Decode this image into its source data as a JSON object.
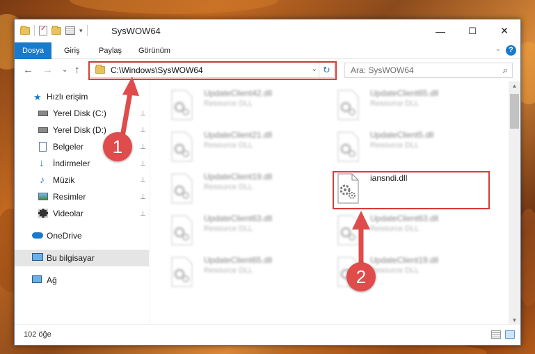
{
  "window": {
    "title": "SysWOW64"
  },
  "window_controls": {
    "minimize": "—",
    "maximize": "☐",
    "close": "✕"
  },
  "ribbon": {
    "tabs": [
      "Dosya",
      "Giriş",
      "Paylaş",
      "Görünüm"
    ],
    "help": "?",
    "collapse": "⌄"
  },
  "nav": {
    "back": "←",
    "forward": "→",
    "recent": "⌄",
    "up": "↑"
  },
  "address": {
    "path": "C:\\Windows\\SysWOW64",
    "dropdown": "⌄",
    "refresh": "↻"
  },
  "search": {
    "placeholder": "Ara: SysWOW64",
    "icon": "⌕"
  },
  "sidebar": {
    "items": [
      {
        "label": "Hızlı erişim",
        "icon": "star-icon",
        "pinned": false
      },
      {
        "label": "Yerel Disk (C:)",
        "icon": "drive-icon",
        "pinned": true
      },
      {
        "label": "Yerel Disk (D:)",
        "icon": "drive-icon",
        "pinned": true
      },
      {
        "label": "Belgeler",
        "icon": "documents-icon",
        "pinned": true
      },
      {
        "label": "İndirmeler",
        "icon": "download-icon",
        "pinned": true
      },
      {
        "label": "Müzik",
        "icon": "music-icon",
        "pinned": true
      },
      {
        "label": "Resimler",
        "icon": "pictures-icon",
        "pinned": true
      },
      {
        "label": "Videolar",
        "icon": "videos-icon",
        "pinned": true
      },
      {
        "label": "OneDrive",
        "icon": "cloud-icon",
        "pinned": false
      },
      {
        "label": "Bu bilgisayar",
        "icon": "computer-icon",
        "pinned": false,
        "selected": true
      },
      {
        "label": "Ağ",
        "icon": "network-icon",
        "pinned": false
      }
    ],
    "pin_glyph": "📌"
  },
  "files": [
    {
      "name": "UpdateClient42.dll",
      "type": "Resource DLL",
      "blurred": true
    },
    {
      "name": "UpdateClient65.dll",
      "type": "Resource DLL",
      "blurred": true
    },
    {
      "name": "UpdateClient21.dll",
      "type": "Resource DLL",
      "blurred": true
    },
    {
      "name": "UpdateClient5.dll",
      "type": "Resource DLL",
      "blurred": true
    },
    {
      "name": "UpdateClient19.dll",
      "type": "Resource DLL",
      "blurred": true
    },
    {
      "name": "iansndi.dll",
      "type": "",
      "blurred": false
    },
    {
      "name": "UpdateClient63.dll",
      "type": "Resource DLL",
      "blurred": true
    },
    {
      "name": "UpdateClient63.dll",
      "type": "Resource DLL",
      "blurred": true
    },
    {
      "name": "UpdateClient65.dll",
      "type": "Resource DLL",
      "blurred": true
    },
    {
      "name": "UpdateClient19.dll",
      "type": "Resource DLL",
      "blurred": true
    }
  ],
  "status": {
    "count": "102 öğe"
  },
  "callouts": [
    "1",
    "2"
  ],
  "colors": {
    "accent": "#1979ca",
    "highlight": "#d83b3b",
    "callout": "#e04b4b"
  }
}
